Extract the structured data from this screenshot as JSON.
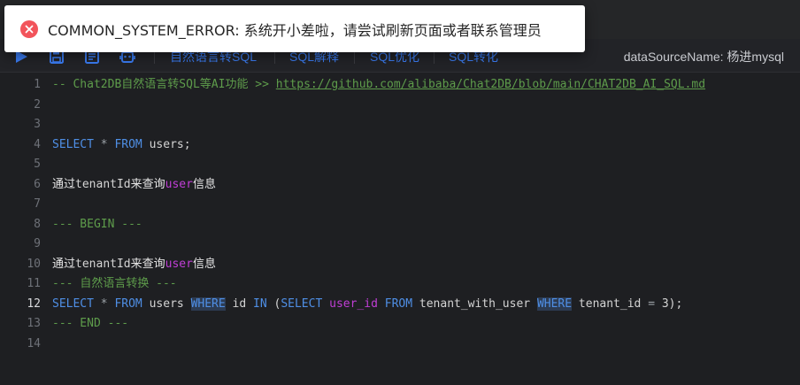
{
  "toast": {
    "message": "COMMON_SYSTEM_ERROR: 系统开小差啦，请尝试刷新页面或者联系管理员",
    "icon": "error-close-icon",
    "color": "#f2545b"
  },
  "toolbar": {
    "icons": [
      "run-icon",
      "save-icon",
      "format-icon",
      "ai-icon"
    ],
    "actions": [
      "自然语言转SQL",
      "SQL解释",
      "SQL优化",
      "SQL转化"
    ],
    "datasource": "dataSourceName: 杨进mysql"
  },
  "editor": {
    "active_line": 12,
    "lines": [
      {
        "n": "1",
        "segs": [
          {
            "t": "-- Chat2DB",
            "c": "cmt"
          },
          {
            "t": "自然语言转",
            "c": "cn-cmt"
          },
          {
            "t": "SQL",
            "c": "cmt"
          },
          {
            "t": "等",
            "c": "cn-cmt"
          },
          {
            "t": "AI",
            "c": "cmt"
          },
          {
            "t": "功能",
            "c": "cn-cmt"
          },
          {
            "t": " >> ",
            "c": "cmt"
          },
          {
            "t": "https://github.com/alibaba/Chat2DB/blob/main/CHAT2DB_AI_SQL.md",
            "c": "url"
          }
        ]
      },
      {
        "n": "2",
        "segs": []
      },
      {
        "n": "3",
        "segs": []
      },
      {
        "n": "4",
        "segs": [
          {
            "t": "SELECT",
            "c": "kw"
          },
          {
            "t": " * ",
            "c": "op"
          },
          {
            "t": "FROM",
            "c": "kw"
          },
          {
            "t": " users;",
            "c": ""
          }
        ]
      },
      {
        "n": "5",
        "segs": []
      },
      {
        "n": "6",
        "segs": [
          {
            "t": "通过",
            "c": "cn"
          },
          {
            "t": "tenantId",
            "c": ""
          },
          {
            "t": "来查询",
            "c": "cn"
          },
          {
            "t": "user",
            "c": "fn"
          },
          {
            "t": "信息",
            "c": "cn"
          }
        ]
      },
      {
        "n": "7",
        "segs": []
      },
      {
        "n": "8",
        "segs": [
          {
            "t": "--- BEGIN ---",
            "c": "cmt"
          }
        ]
      },
      {
        "n": "9",
        "segs": []
      },
      {
        "n": "10",
        "segs": [
          {
            "t": "通过",
            "c": "cn"
          },
          {
            "t": "tenantId",
            "c": ""
          },
          {
            "t": "来查询",
            "c": "cn"
          },
          {
            "t": "user",
            "c": "fn"
          },
          {
            "t": "信息",
            "c": "cn"
          }
        ]
      },
      {
        "n": "11",
        "segs": [
          {
            "t": "--- ",
            "c": "cmt"
          },
          {
            "t": "自然语言转换",
            "c": "cn-cmt"
          },
          {
            "t": " ---",
            "c": "cmt"
          }
        ]
      },
      {
        "n": "12",
        "segs": [
          {
            "t": "SELECT",
            "c": "kw"
          },
          {
            "t": " * ",
            "c": "op"
          },
          {
            "t": "FROM",
            "c": "kw"
          },
          {
            "t": " users ",
            "c": ""
          },
          {
            "t": "WHERE",
            "c": "kw-hl"
          },
          {
            "t": " id ",
            "c": ""
          },
          {
            "t": "IN",
            "c": "kw"
          },
          {
            "t": " (",
            "c": ""
          },
          {
            "t": "SELECT",
            "c": "kw"
          },
          {
            "t": " ",
            "c": ""
          },
          {
            "t": "user_id",
            "c": "fn"
          },
          {
            "t": " ",
            "c": ""
          },
          {
            "t": "FROM",
            "c": "kw"
          },
          {
            "t": " tenant_with_user ",
            "c": ""
          },
          {
            "t": "WHERE",
            "c": "kw-hl"
          },
          {
            "t": " tenant_id ",
            "c": ""
          },
          {
            "t": "=",
            "c": "op"
          },
          {
            "t": " 3);",
            "c": "num"
          }
        ]
      },
      {
        "n": "13",
        "segs": [
          {
            "t": "--- END ---",
            "c": "cmt"
          }
        ]
      },
      {
        "n": "14",
        "segs": []
      }
    ]
  }
}
